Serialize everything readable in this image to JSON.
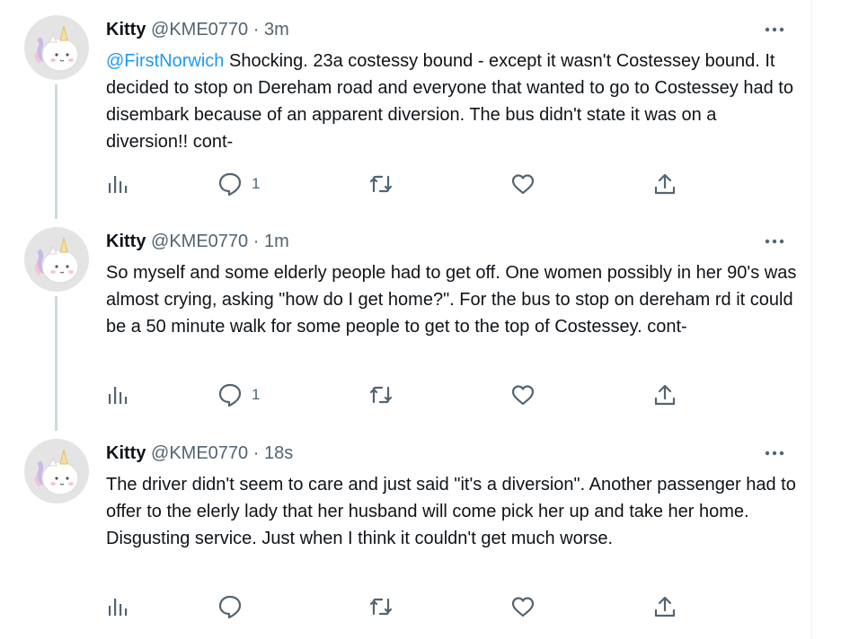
{
  "tweets": [
    {
      "name": "Kitty",
      "handle": "@KME0770",
      "separator": "·",
      "time": "3m",
      "mention": "@FirstNorwich",
      "text": " Shocking. 23a costessy bound - except it wasn't Costessey bound. It decided to stop on Dereham road and everyone that wanted to go to Costessey had to disembark because of an apparent diversion. The bus didn't state it was on a diversion!! cont-",
      "reply_count": "1"
    },
    {
      "name": "Kitty",
      "handle": "@KME0770",
      "separator": "·",
      "time": "1m",
      "mention": "",
      "text": "So myself and some elderly people had to get off. One women possibly in her 90's was almost crying, asking \"how do I get home?\". For the bus to stop on dereham rd it could be a 50 minute walk for some people to get to the top of Costessey. cont-",
      "reply_count": "1"
    },
    {
      "name": "Kitty",
      "handle": "@KME0770",
      "separator": "·",
      "time": "18s",
      "mention": "",
      "text": "The driver didn't seem to care and just said \"it's a diversion\". Another passenger had to offer to the elerly lady that her husband will come pick her up and take her home. Disgusting service. Just when I think it couldn't get much worse.",
      "reply_count": ""
    }
  ],
  "icons": {
    "avatar": "unicorn-avatar",
    "more": "more-icon",
    "analytics": "analytics-icon",
    "reply": "reply-icon",
    "retweet": "retweet-icon",
    "like": "like-icon",
    "share": "share-icon"
  },
  "colors": {
    "accent": "#1d9bf0",
    "secondary_text": "#536471",
    "thread_line": "#cfd9de"
  }
}
